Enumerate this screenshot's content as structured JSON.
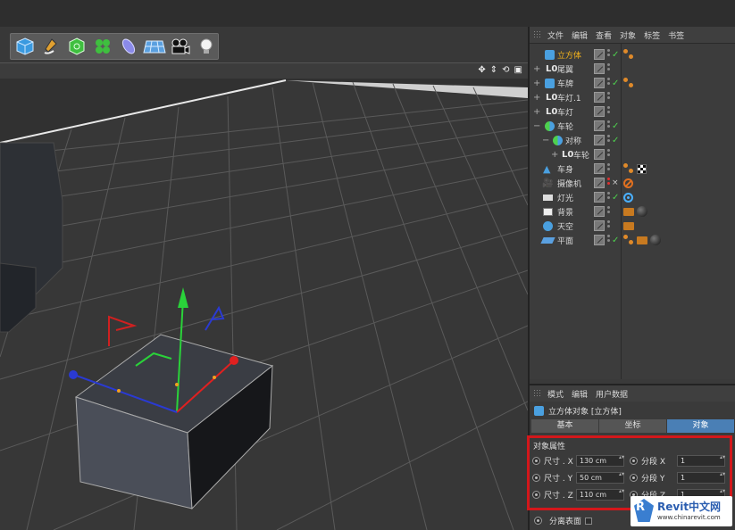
{
  "toolbar": {
    "tools": [
      "cube-tool-icon",
      "pen-tool-icon",
      "subdivision-tool-icon",
      "cloner-tool-icon",
      "deformer-tool-icon",
      "floor-tool-icon",
      "camera-tool-icon",
      "light-tool-icon"
    ]
  },
  "viewport": {
    "nav_icons": [
      "✥",
      "⇕",
      "⟲",
      "▣"
    ]
  },
  "object_manager": {
    "menu": [
      "文件",
      "编辑",
      "查看",
      "对象",
      "标签",
      "书签"
    ],
    "objects": [
      {
        "name": "立方体",
        "icon": "cube",
        "selected": true,
        "indent": 0
      },
      {
        "name": "尾翼",
        "icon": "null",
        "selected": false,
        "indent": 0
      },
      {
        "name": "车牌",
        "icon": "cube",
        "selected": false,
        "indent": 0
      },
      {
        "name": "车灯.1",
        "icon": "null",
        "selected": false,
        "indent": 0
      },
      {
        "name": "车灯",
        "icon": "null",
        "selected": false,
        "indent": 0
      },
      {
        "name": "车轮",
        "icon": "sphere",
        "selected": false,
        "indent": 0
      },
      {
        "name": "对称",
        "icon": "sphere",
        "selected": false,
        "indent": 1
      },
      {
        "name": "车轮",
        "icon": "null",
        "selected": false,
        "indent": 2
      },
      {
        "name": "车身",
        "icon": "cube",
        "selected": false,
        "indent": 0
      },
      {
        "name": "摄像机",
        "icon": "camera",
        "selected": false,
        "indent": 0
      },
      {
        "name": "灯光",
        "icon": "light",
        "selected": false,
        "indent": 0
      },
      {
        "name": "背景",
        "icon": "bg",
        "selected": false,
        "indent": 0
      },
      {
        "name": "天空",
        "icon": "sky",
        "selected": false,
        "indent": 0
      },
      {
        "name": "平面",
        "icon": "plane",
        "selected": false,
        "indent": 0
      }
    ]
  },
  "attribute_manager": {
    "menu": [
      "模式",
      "编辑",
      "用户数据"
    ],
    "title": "立方体对象 [立方体]",
    "tabs": [
      "基本",
      "坐标",
      "对象"
    ],
    "active_tab": "对象",
    "section_title": "对象属性",
    "props": [
      {
        "label": "尺寸 . X",
        "value": "130 cm",
        "seg_label": "分段 X",
        "seg_value": "1"
      },
      {
        "label": "尺寸 . Y",
        "value": "50 cm",
        "seg_label": "分段 Y",
        "seg_value": "1"
      },
      {
        "label": "尺寸 . Z",
        "value": "110 cm",
        "seg_label": "分段 Z",
        "seg_value": "1"
      }
    ],
    "separate_surfaces": "分离表面"
  },
  "watermark": {
    "brand": "Revit中文网",
    "url": "www.chinarevit.com"
  },
  "colors": {
    "selected_text": "#f2b21c",
    "highlight_box": "#d3171b",
    "active_tab": "#4a7fb5"
  }
}
